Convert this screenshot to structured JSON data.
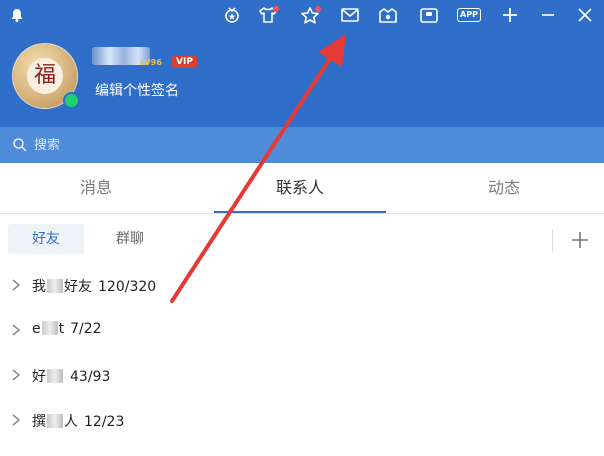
{
  "header": {
    "icons": [
      {
        "name": "bell-icon",
        "has_dot": false
      },
      {
        "name": "medal-icon",
        "has_dot": false
      },
      {
        "name": "tshirt-icon",
        "has_dot": true
      },
      {
        "name": "star-icon",
        "has_dot": true
      },
      {
        "name": "mail-icon",
        "has_dot": false
      },
      {
        "name": "tray-icon",
        "has_dot": false
      },
      {
        "name": "camera-icon",
        "has_dot": false
      },
      {
        "name": "app-icon",
        "label": "APP"
      },
      {
        "name": "plus-icon"
      },
      {
        "name": "minimize-icon"
      },
      {
        "name": "close-icon"
      }
    ],
    "profile": {
      "avatar_char": "福",
      "level": "LV96",
      "vip": "VIP",
      "signature": "编辑个性签名",
      "online": true
    },
    "colors": {
      "brand": "#2f6fc9",
      "search_bg": "#4e8bd8",
      "online": "#20d16b",
      "badge": "#ff4d4f"
    }
  },
  "search": {
    "placeholder": "搜索"
  },
  "tabs": [
    {
      "label": "消息",
      "active": false
    },
    {
      "label": "联系人",
      "active": true
    },
    {
      "label": "动态",
      "active": false
    }
  ],
  "subtabs": [
    {
      "label": "好友",
      "active": true
    },
    {
      "label": "群聊",
      "active": false
    }
  ],
  "groups": [
    {
      "pre": "我",
      "post": "好友",
      "count": "120/320"
    },
    {
      "pre": "e",
      "post": "t",
      "count": "7/22"
    },
    {
      "pre": "好",
      "post": "",
      "count": "43/93"
    },
    {
      "pre": "撰",
      "post": "人",
      "count": "12/23"
    }
  ],
  "annotation": {
    "color": "#e53935",
    "points_to": "mail-icon"
  }
}
